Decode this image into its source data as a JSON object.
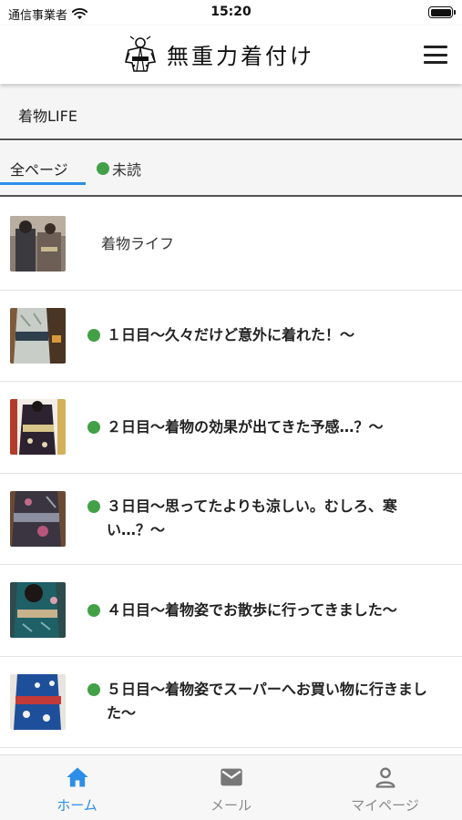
{
  "status_bar": {
    "carrier": "通信事業者",
    "time": "15:20"
  },
  "header": {
    "logo_text": "無重力着付け",
    "menu_icon": "hamburger-menu-icon"
  },
  "page": {
    "title": "着物LIFE"
  },
  "tabs": [
    {
      "label": "全ページ",
      "active": true
    },
    {
      "label": "未読",
      "active": false
    }
  ],
  "colors": {
    "accent_blue": "#2c8ee8",
    "unread_dot": "#43a047"
  },
  "articles": [
    {
      "title": "着物ライフ",
      "unread": false
    },
    {
      "title": "１日目〜久々だけど意外に着れた！〜",
      "unread": true
    },
    {
      "title": "２日目〜着物の効果が出てきた予感…？〜",
      "unread": true
    },
    {
      "title": "３日目〜思ってたよりも涼しい。むしろ、寒い…？〜",
      "unread": true
    },
    {
      "title": "４日目〜着物姿でお散歩に行ってきました〜",
      "unread": true
    },
    {
      "title": "５日目〜着物姿でスーパーへお買い物に行きました〜",
      "unread": true
    }
  ],
  "bottom_nav": [
    {
      "label": "ホーム",
      "icon": "home-icon",
      "active": true
    },
    {
      "label": "メール",
      "icon": "mail-icon",
      "active": false
    },
    {
      "label": "マイページ",
      "icon": "person-icon",
      "active": false
    }
  ]
}
